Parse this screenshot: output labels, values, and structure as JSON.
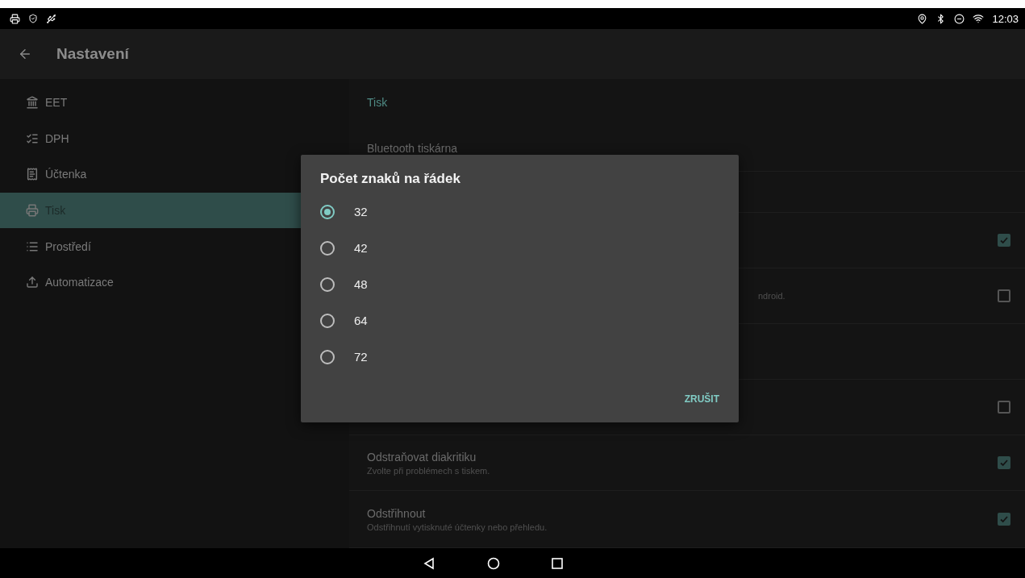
{
  "status_bar": {
    "time": "12:03"
  },
  "app_bar": {
    "title": "Nastavení"
  },
  "sidebar": {
    "items": [
      {
        "label": "EET",
        "selected": false
      },
      {
        "label": "DPH",
        "selected": false
      },
      {
        "label": "Účtenka",
        "selected": false
      },
      {
        "label": "Tisk",
        "selected": true
      },
      {
        "label": "Prostředí",
        "selected": false
      },
      {
        "label": "Automatizace",
        "selected": false
      }
    ]
  },
  "settings": {
    "section": "Tisk",
    "rows": [
      {
        "kind": "plain",
        "title": "Bluetooth tiskárna"
      },
      {
        "kind": "plain"
      },
      {
        "kind": "checkbox",
        "checked": true
      },
      {
        "kind": "checkbox",
        "checked": false,
        "subtitle": "ndroid."
      },
      {
        "kind": "plain"
      },
      {
        "kind": "checkbox",
        "checked": false
      },
      {
        "kind": "checkbox",
        "checked": true,
        "title": "Odstraňovat diakritiku",
        "subtitle": "Zvolte při problémech s tiskem."
      },
      {
        "kind": "checkbox",
        "checked": true,
        "title": "Odstřihnout",
        "subtitle": "Odstřihnutí vytisknuté účtenky nebo přehledu."
      }
    ]
  },
  "dialog": {
    "title": "Počet znaků na řádek",
    "options": [
      {
        "label": "32",
        "selected": true
      },
      {
        "label": "42",
        "selected": false
      },
      {
        "label": "48",
        "selected": false
      },
      {
        "label": "64",
        "selected": false
      },
      {
        "label": "72",
        "selected": false
      }
    ],
    "buttons": [
      "ZRUŠIT"
    ]
  }
}
